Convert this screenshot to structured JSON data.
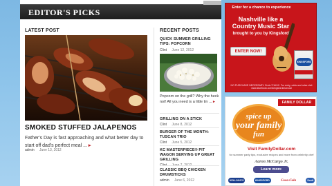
{
  "editors_picks": {
    "title": "EDITOR'S PICKS"
  },
  "latest_post": {
    "heading": "LATEST POST",
    "title": "SMOKED STUFFED JALAPENOS",
    "excerpt": "Father's Day is fast approaching and what better day to start off dad's perfect meal ...",
    "author": "admin",
    "date": "June 13, 2012"
  },
  "recent_posts": {
    "heading": "RECENT POSTS",
    "items": [
      {
        "title": "QUICK SUMMER GRILLING TIPS: POPCORN",
        "author": "Clint",
        "date": "June 12, 2012",
        "excerpt": "Popcorn on the grill? Why the heck not! All you need is a little tin ..."
      },
      {
        "title": "GRILLING ON A STICK",
        "author": "Clint",
        "date": "June 8, 2012"
      },
      {
        "title": "BURGER OF THE MONTH: TUSCAN TRIO",
        "author": "Clint",
        "date": "June 5, 2012"
      },
      {
        "title": "KC MASTERPIECE® PIT WAGON SERVING UP GREAT GRILLING",
        "author": "Clint",
        "date": "June 7, 2012"
      },
      {
        "title": "CLASSIC BBQ CHICKEN DRUMSTICKS",
        "author": "admin",
        "date": "June 6, 2012"
      }
    ]
  },
  "ad_kingsford": {
    "headline": "Enter for a chance to experience",
    "big": "Nashville like a Country Music Star",
    "byline": "brought to you by Kingsford!",
    "button": "ENTER NOW!",
    "bag_brand": "KINGSFORD",
    "fine_print": "NO PURCHASE NECESSARY. Ends 7/16/12. For entry, odds and rules visit www.facebook.com/kingsfordcharcoal",
    "colors": {
      "background": "#c8151b"
    }
  },
  "ad_family_dollar": {
    "logo": "FAMILY DOLLAR",
    "badge_line1": "spice up",
    "badge_line2": "your family",
    "badge_line3": "fun",
    "visit": "Visit FamilyDollar.com",
    "visit_sub": "for summer party tips, exclusive recipes and more from celebrity chef",
    "signature": "Aaron McCargo Jr.",
    "button": "Learn more",
    "brands": [
      "KELLOGG'S",
      "KINGSFORD",
      "Coca-Cola",
      "Scott"
    ],
    "colors": {
      "accent": "#c8151b",
      "badge": "#e8861e",
      "button": "#4c4c8f"
    }
  }
}
